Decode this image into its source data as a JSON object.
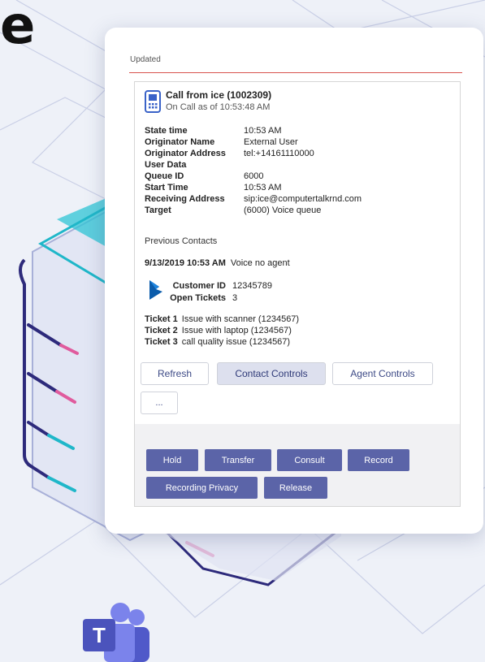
{
  "hero": {
    "fragment": "e"
  },
  "card": {
    "status": "Updated"
  },
  "call": {
    "title": "Call from ice (1002309)",
    "subtitle": "On Call as of 10:53:48 AM"
  },
  "details": [
    {
      "key": "State time",
      "value": "10:53 AM"
    },
    {
      "key": "Originator Name",
      "value": "External User"
    },
    {
      "key": "Originator Address",
      "value": "tel:+14161110000"
    },
    {
      "key": "User Data",
      "value": ""
    },
    {
      "key": "Queue ID",
      "value": "6000"
    },
    {
      "key": "Start Time",
      "value": "10:53 AM"
    },
    {
      "key": "Receiving Address",
      "value": "sip:ice@computertalkrnd.com"
    },
    {
      "key": "Target",
      "value": "(6000) Voice queue"
    }
  ],
  "previous": {
    "label": "Previous Contacts",
    "datetime": "9/13/2019 10:53 AM",
    "result": "Voice no agent"
  },
  "customer": {
    "id_label": "Customer ID",
    "id_value": "12345789",
    "tickets_label": "Open Tickets",
    "tickets_value": "3"
  },
  "tickets": [
    {
      "label": "Ticket 1",
      "text": "Issue with scanner (1234567)"
    },
    {
      "label": "Ticket 2",
      "text": "Issue with laptop (1234567)"
    },
    {
      "label": "Ticket 3",
      "text": "call quality issue (1234567)"
    }
  ],
  "tabs": {
    "refresh": "Refresh",
    "contact_controls": "Contact Controls",
    "agent_controls": "Agent Controls",
    "more": "..."
  },
  "actions": {
    "hold": "Hold",
    "transfer": "Transfer",
    "consult": "Consult",
    "record": "Record",
    "recording_privacy": "Recording Privacy",
    "release": "Release"
  },
  "colors": {
    "accent": "#5b64a8",
    "rule": "#d9534f",
    "teams": "#5059c9"
  },
  "icons": {
    "call": "phone-icon",
    "crm": "dynamics-icon",
    "brand": "teams-logo-icon"
  }
}
